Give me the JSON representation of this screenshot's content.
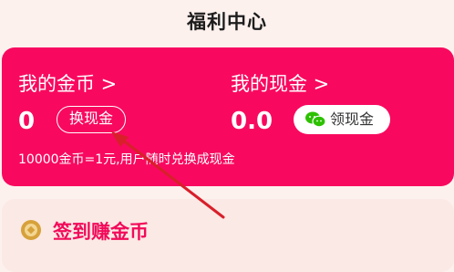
{
  "page": {
    "title": "福利中心"
  },
  "coins": {
    "label": "我的金币 >",
    "value": "0",
    "exchange_button": "换现金"
  },
  "cash": {
    "label": "我的现金 >",
    "value": "0.0",
    "withdraw_button": "领现金"
  },
  "note": "10000金币=1元,用户随时兑换成现金",
  "checkin": {
    "title": "签到赚金币"
  },
  "colors": {
    "accent": "#f8095f",
    "wechat": "#2dc100",
    "coin": "#d7a13b",
    "arrow": "#d8202a"
  },
  "icons": [
    "wechat-icon",
    "coin-icon",
    "arrow-annotation"
  ]
}
